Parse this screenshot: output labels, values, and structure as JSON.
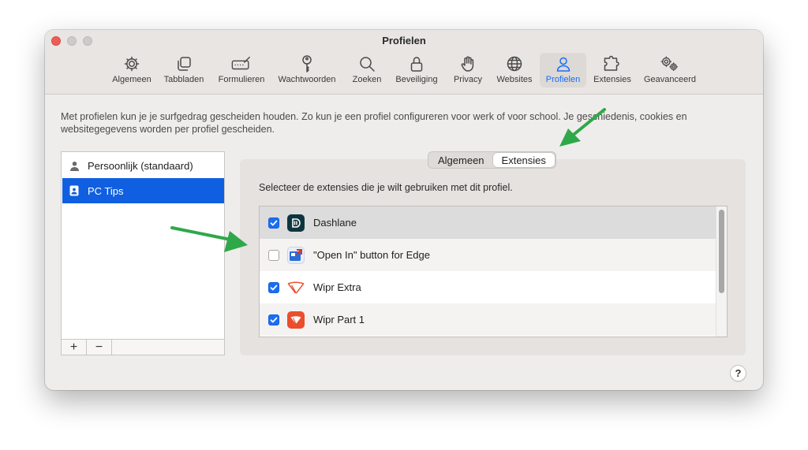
{
  "window": {
    "title": "Profielen"
  },
  "toolbar": {
    "tabs": [
      {
        "label": "Algemeen",
        "icon": "gear-icon"
      },
      {
        "label": "Tabbladen",
        "icon": "tabs-icon"
      },
      {
        "label": "Formulieren",
        "icon": "form-icon"
      },
      {
        "label": "Wachtwoorden",
        "icon": "key-icon"
      },
      {
        "label": "Zoeken",
        "icon": "search-icon"
      },
      {
        "label": "Beveiliging",
        "icon": "lock-icon"
      },
      {
        "label": "Privacy",
        "icon": "hand-icon"
      },
      {
        "label": "Websites",
        "icon": "globe-icon"
      },
      {
        "label": "Profielen",
        "icon": "person-icon",
        "active": true
      },
      {
        "label": "Extensies",
        "icon": "puzzle-icon"
      },
      {
        "label": "Geavanceerd",
        "icon": "gears-icon"
      }
    ]
  },
  "description": "Met profielen kun je je surfgedrag gescheiden houden. Zo kun je een profiel configureren voor werk of voor school. Je geschiedenis, cookies en websitegegevens worden per profiel gescheiden.",
  "profiles": {
    "items": [
      {
        "label": "Persoonlijk (standaard)",
        "icon": "person-icon",
        "selected": false
      },
      {
        "label": "PC Tips",
        "icon": "id-badge-icon",
        "selected": true
      }
    ],
    "add_label": "+",
    "remove_label": "−"
  },
  "segmented": {
    "options": [
      {
        "label": "Algemeen",
        "selected": false
      },
      {
        "label": "Extensies",
        "selected": true
      }
    ]
  },
  "extensions": {
    "instruction": "Selecteer de extensies die je wilt gebruiken met dit profiel.",
    "items": [
      {
        "name": "Dashlane",
        "checked": true,
        "icon": "dashlane-icon"
      },
      {
        "name": "\"Open In\" button for Edge",
        "checked": false,
        "icon": "open-in-edge-icon"
      },
      {
        "name": "Wipr Extra",
        "checked": true,
        "icon": "wipr-extra-icon"
      },
      {
        "name": "Wipr Part 1",
        "checked": true,
        "icon": "wipr-part-1-icon"
      }
    ]
  },
  "help": {
    "label": "?"
  },
  "colors": {
    "accent": "#1a6df5",
    "selection": "#0f5fe0",
    "arrow": "#2fa84a",
    "close": "#ee5d55"
  }
}
